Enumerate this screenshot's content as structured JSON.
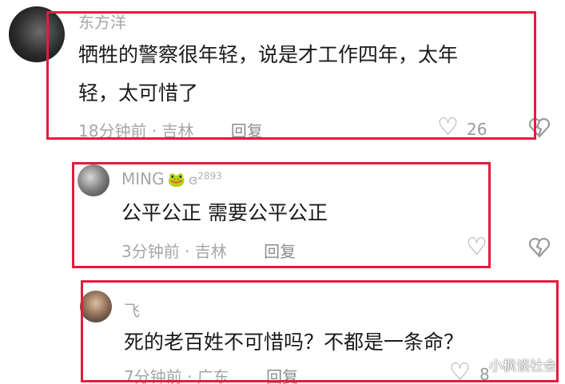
{
  "comments": [
    {
      "user": "东方洋",
      "text_line1": "牺牲的警察很年轻，说是才工作四年，太年",
      "text_line2": "轻，太可惜了",
      "time_location": "18分钟前 · 吉林",
      "reply_label": "回复",
      "likes": "26",
      "like_icon": "heart-outline",
      "dislike_icon": "broken-heart"
    },
    {
      "user": "MING",
      "badge_icon": "frog-emoji",
      "level_prefix": "ɞ",
      "level_value": "2893",
      "text": "公平公正  需要公平公正",
      "time_location": "3分钟前 · 吉林",
      "reply_label": "回复",
      "like_icon": "heart-outline",
      "dislike_icon": "broken-heart"
    },
    {
      "user": "飞",
      "text": "死的老百姓不可惜吗？不都是一条命？",
      "time_location": "7分钟前 · 广东",
      "reply_label": "回复",
      "likes": "8",
      "like_icon": "heart-outline"
    }
  ],
  "watermark": "小枫谈社会",
  "colors": {
    "highlight_border": "#e8193c",
    "muted_text": "#a6a6a6",
    "body_text": "#1a1a1a"
  }
}
